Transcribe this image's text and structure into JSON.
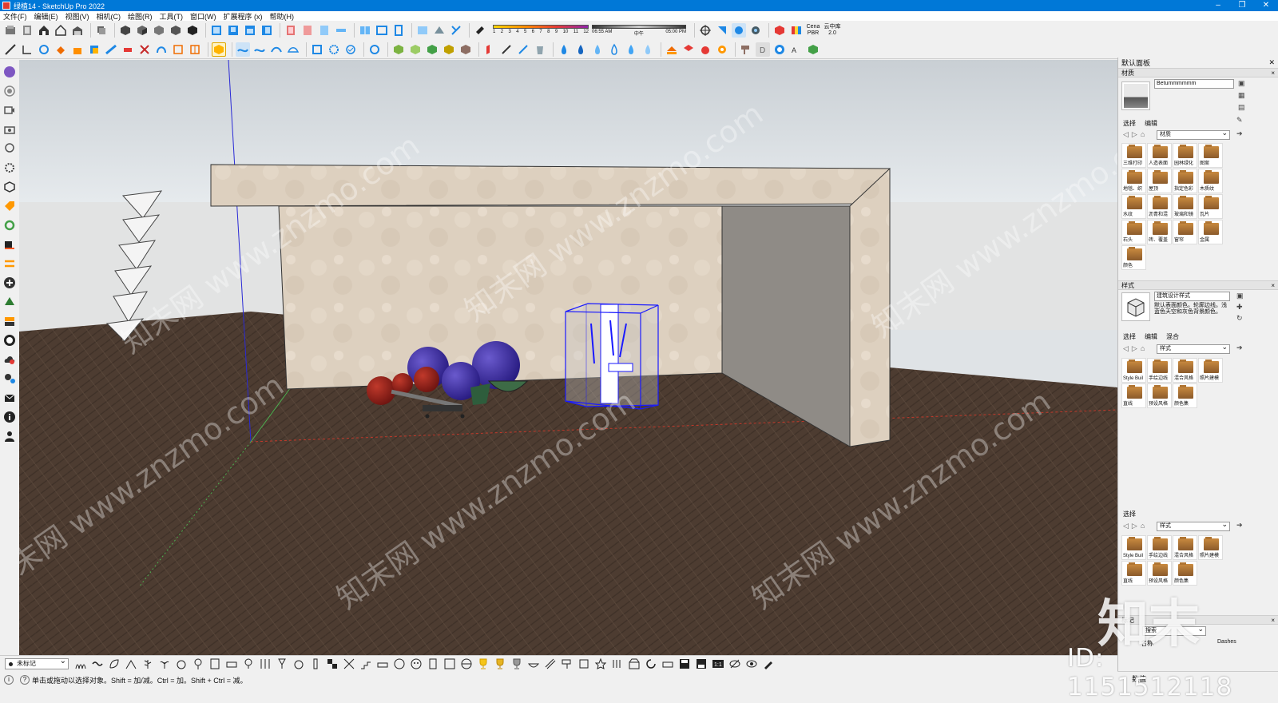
{
  "window": {
    "title": "绿植14 - SketchUp Pro 2022",
    "buttons": [
      "–",
      "❐",
      "✕"
    ]
  },
  "menu": [
    "文件(F)",
    "编辑(E)",
    "视图(V)",
    "相机(C)",
    "绘图(R)",
    "工具(T)",
    "窗口(W)",
    "扩展程序 (x)",
    "帮助(H)"
  ],
  "toolbar": {
    "month_numbers": [
      "1",
      "2",
      "3",
      "4",
      "5",
      "6",
      "7",
      "8",
      "9",
      "10",
      "11",
      "12"
    ],
    "time_start": "06:55 AM",
    "time_mid": "中午",
    "time_end": "05:00 PM",
    "pbr_label": "Cena PBR",
    "cloud_label": "云中库2.0"
  },
  "tray": {
    "title": "默认面板",
    "materials": {
      "section": "材质",
      "name_value": "Betummmmmm",
      "tab_select": "选择",
      "tab_edit": "编辑",
      "combo": "材质",
      "items": [
        "三维打印",
        "人造表面",
        "园林绿化",
        "图案",
        "地毯、织",
        "屋顶",
        "指定色彩",
        "木质纹",
        "水纹",
        "沥青和混",
        "玻璃和镜",
        "瓦片",
        "石头",
        "砖、覆盖",
        "窗帘",
        "金属",
        "颜色"
      ]
    },
    "styles": {
      "section": "样式",
      "name_value": "建筑设计样式",
      "description": "默认表面颜色。轮廓边线。浅蓝色天空和灰色背景颜色。",
      "tab_select": "选择",
      "tab_edit": "编辑",
      "tab_mix": "混合",
      "combo": "样式",
      "items": [
        "Style Buil",
        "手绘边线",
        "混合风格",
        "照片建模",
        "直线",
        "预设风格",
        "颜色集"
      ]
    },
    "mix": {
      "tab_select": "选择",
      "combo": "样式",
      "items": [
        "Style Buil",
        "手绘边线",
        "混合风格",
        "照片建模",
        "直线",
        "预设风格",
        "颜色集"
      ]
    },
    "tags": {
      "section": "标记",
      "search_placeholder": "搜索",
      "col_name": "名称",
      "col_dashes": "Dashes"
    },
    "measurements_label": "数值"
  },
  "statusbar": {
    "tag_combo": "未标记",
    "hint": "单击或拖动以选择对象。Shift = 加/减。Ctrl = 加。Shift + Ctrl = 减。"
  },
  "watermark": {
    "text": "知末网 www.znzmo.com",
    "brand": "知末",
    "id": "ID: 1151512118"
  },
  "colors": {
    "titlebar": "#0078d7",
    "selection": "#1a1aff",
    "floor": "#4a3a30",
    "sky": "#dfe3e6",
    "wall": "#ddd0bf"
  }
}
